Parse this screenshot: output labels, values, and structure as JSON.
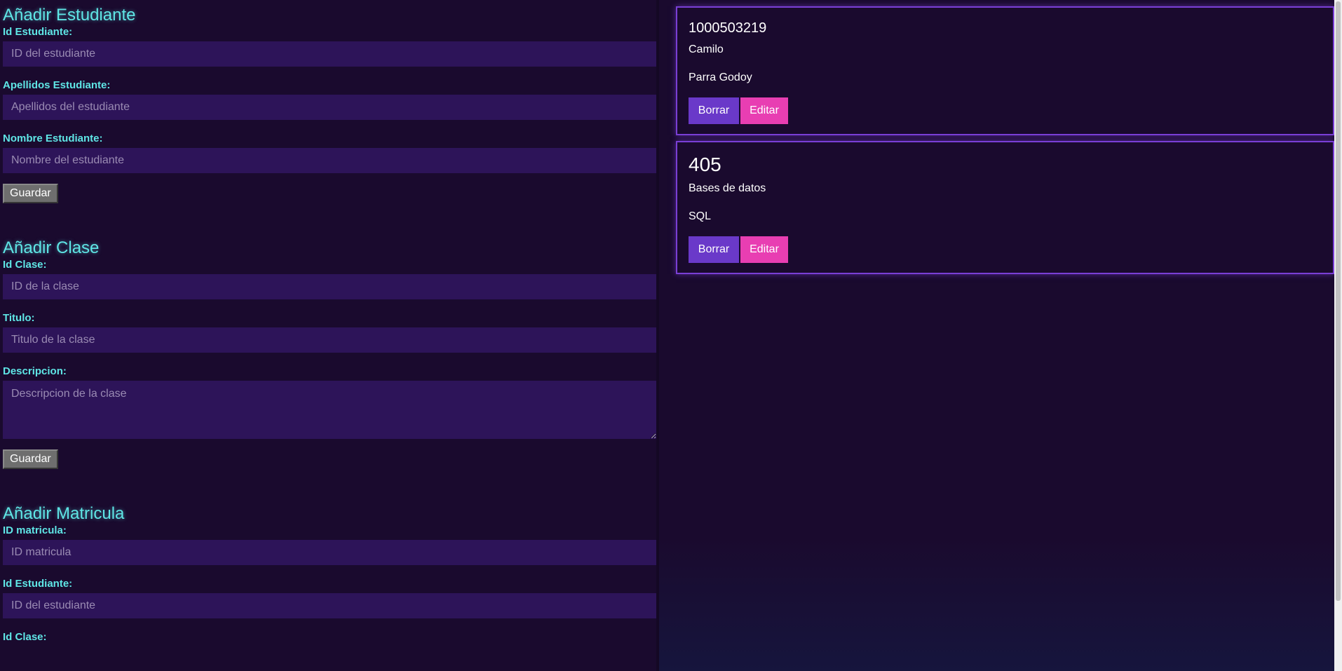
{
  "student_form": {
    "title": "Añadir Estudiante",
    "fields": [
      {
        "label": "Id Estudiante:",
        "placeholder": "ID del estudiante"
      },
      {
        "label": "Apellidos Estudiante:",
        "placeholder": "Apellidos del estudiante"
      },
      {
        "label": "Nombre Estudiante:",
        "placeholder": "Nombre del estudiante"
      }
    ],
    "save_label": "Guardar"
  },
  "class_form": {
    "title": "Añadir Clase",
    "fields": [
      {
        "label": "Id Clase:",
        "placeholder": "ID de la clase"
      },
      {
        "label": "Titulo:",
        "placeholder": "Titulo de la clase"
      },
      {
        "label": "Descripcion:",
        "placeholder": "Descripcion de la clase"
      }
    ],
    "save_label": "Guardar"
  },
  "enrollment_form": {
    "title": "Añadir Matricula",
    "fields": [
      {
        "label": "ID matricula:",
        "placeholder": "ID matricula"
      },
      {
        "label": "Id Estudiante:",
        "placeholder": "ID del estudiante"
      },
      {
        "label": "Id Clase:",
        "placeholder": ""
      }
    ]
  },
  "cards": [
    {
      "id": "1000503219",
      "line1": "Camilo",
      "line2": "Parra Godoy",
      "delete_label": "Borrar",
      "edit_label": "Editar"
    },
    {
      "id": "405",
      "line1": "Bases de datos",
      "line2": "SQL",
      "delete_label": "Borrar",
      "edit_label": "Editar"
    }
  ],
  "colors": {
    "background": "#1a0a2e",
    "label": "#5fe6e6",
    "input": "#2d1459",
    "card_border": "#7a3fd6",
    "delete": "#6a39c9",
    "edit": "#e83eb2"
  }
}
